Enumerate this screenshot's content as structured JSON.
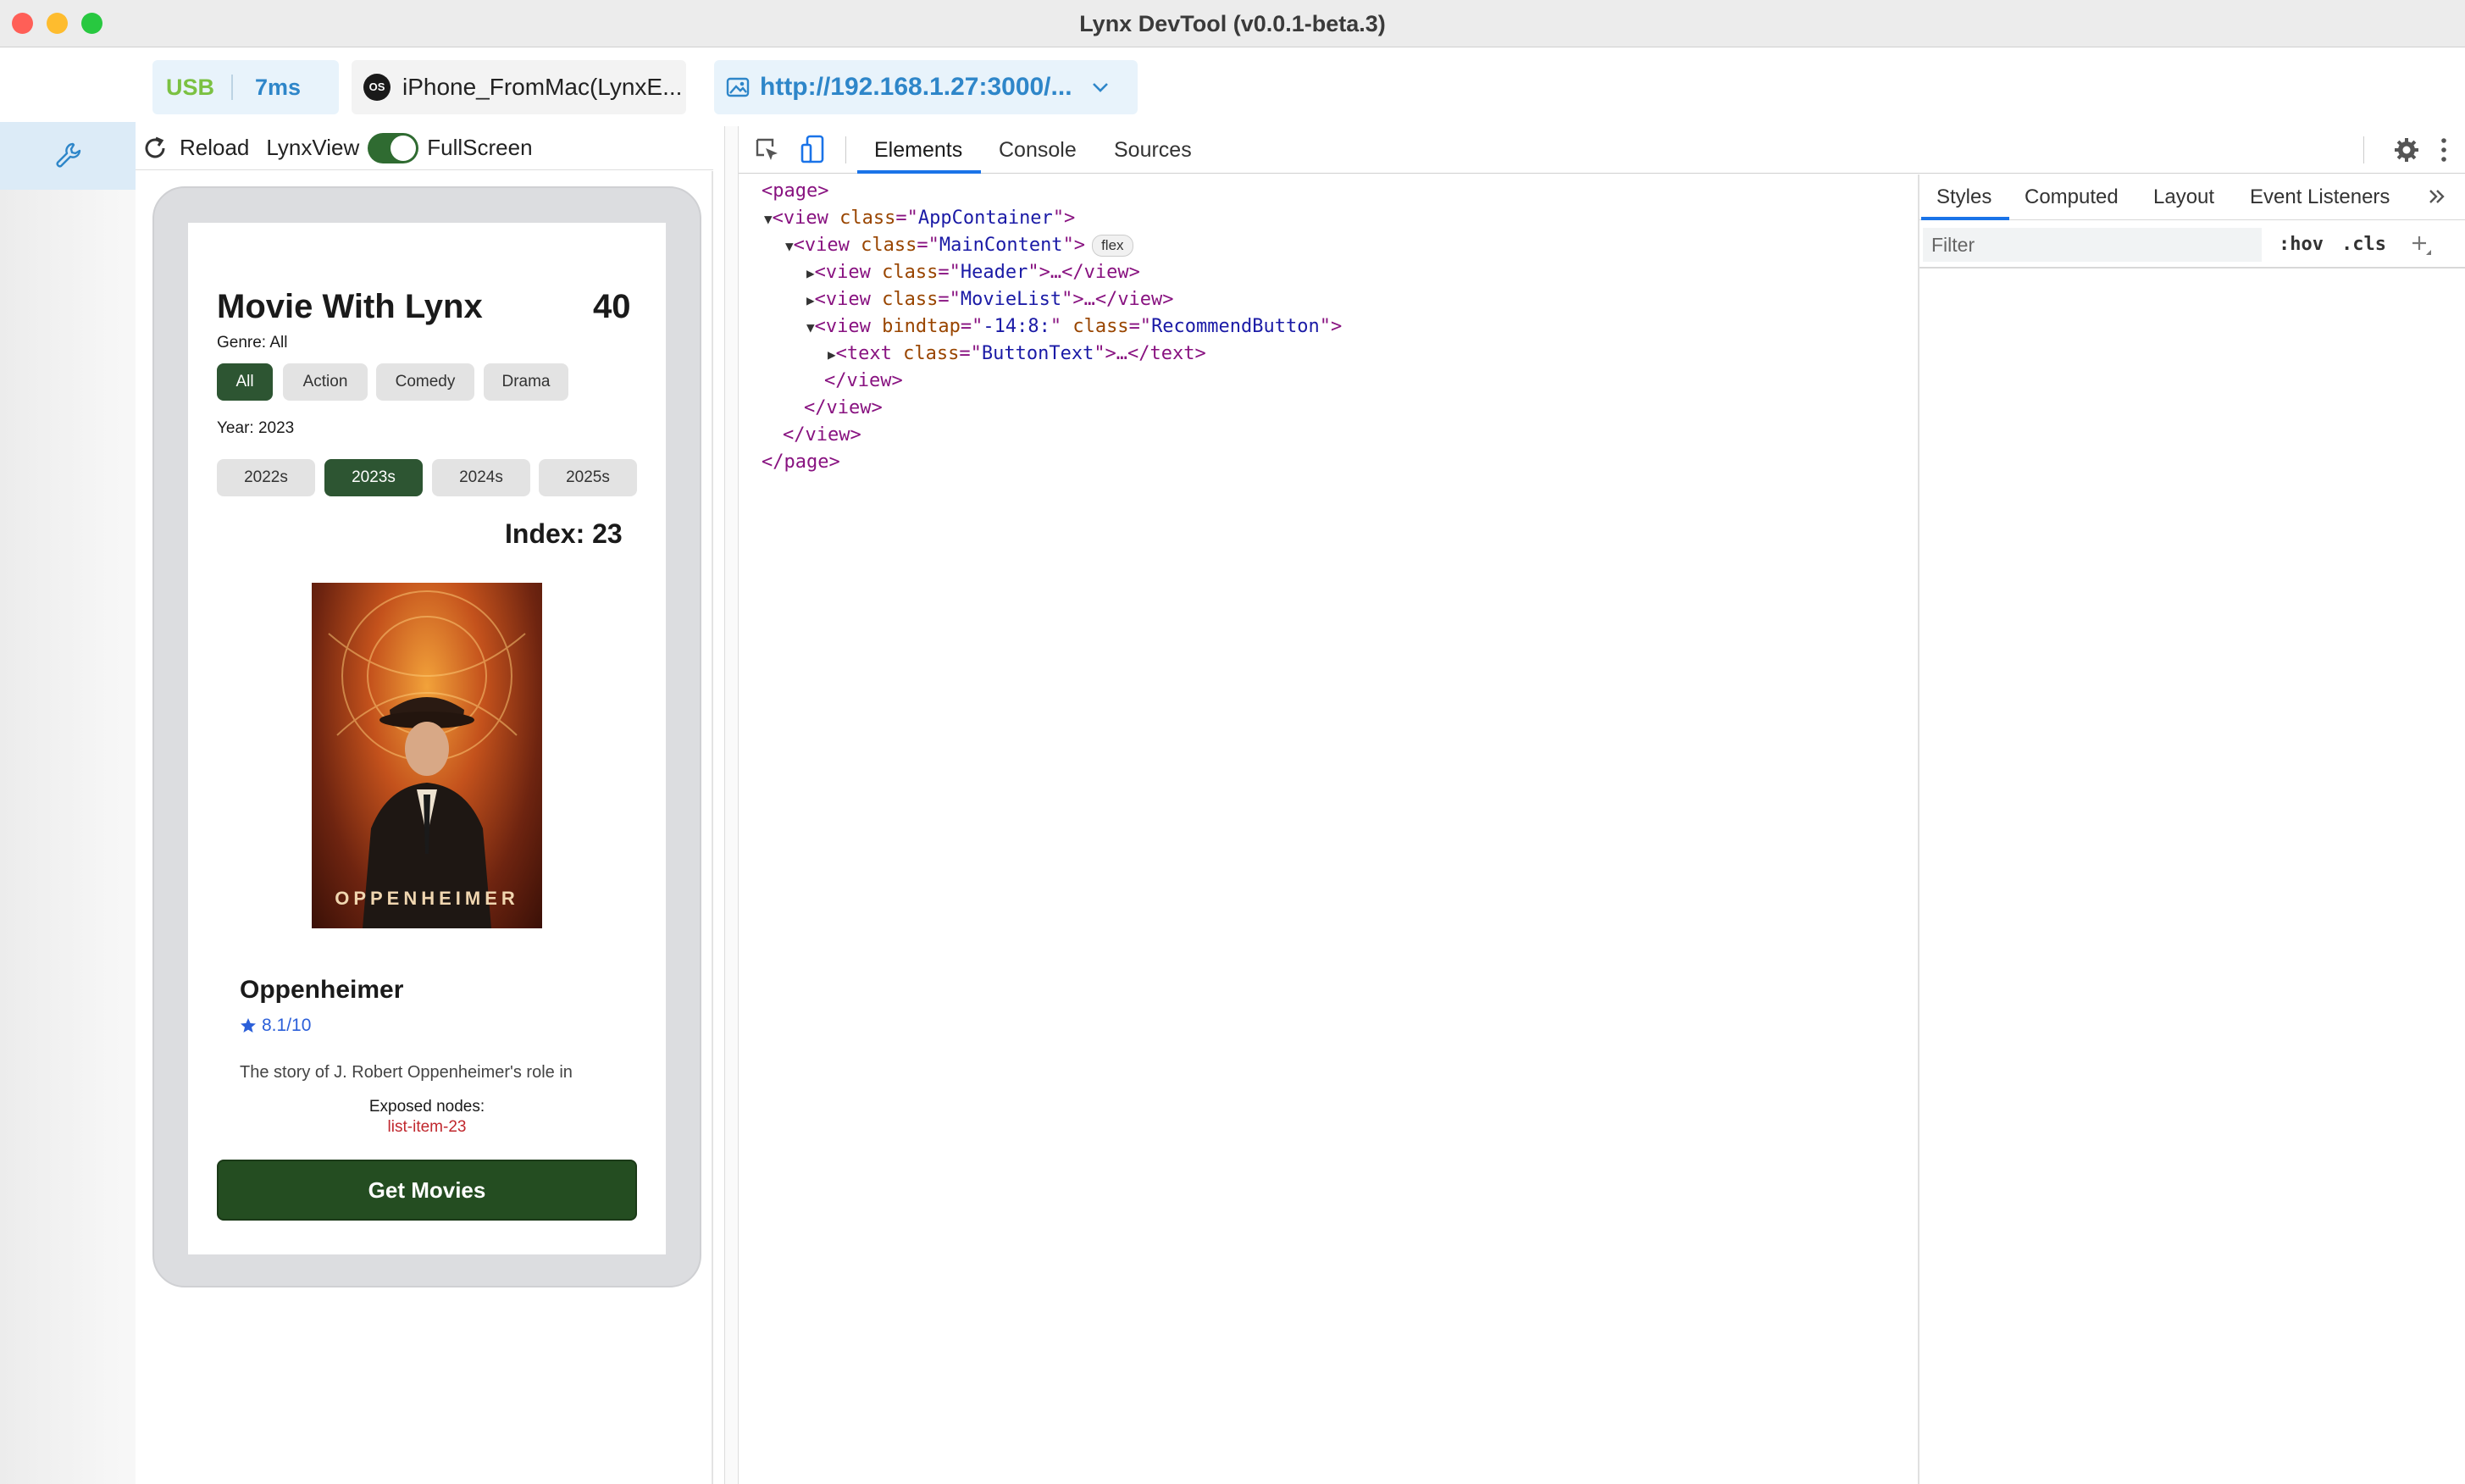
{
  "window": {
    "title": "Lynx DevTool (v0.0.1-beta.3)"
  },
  "toolbar": {
    "connection": "USB",
    "latency": "7ms",
    "os_badge": "OS",
    "device": "iPhone_FromMac(LynxE...",
    "url": "http://192.168.1.27:3000/..."
  },
  "preview": {
    "reload_label": "Reload",
    "lynxview_label": "LynxView",
    "fullscreen_label": "FullScreen",
    "fullscreen_on": true
  },
  "app": {
    "title": "Movie With Lynx",
    "count": "40",
    "genre_label": "Genre: All",
    "genres": [
      "All",
      "Action",
      "Comedy",
      "Drama"
    ],
    "active_genre": "All",
    "year_label": "Year: 2023",
    "years": [
      "2022s",
      "2023s",
      "2024s",
      "2025s"
    ],
    "active_year": "2023s",
    "index_label": "Index: 23",
    "poster_text": "OPPENHEIMER",
    "movie_title": "Oppenheimer",
    "rating": "8.1/10",
    "description": "The story of J. Robert Oppenheimer's role in",
    "exposed_label": "Exposed nodes:",
    "exposed_value": "list-item-23",
    "button": "Get Movies"
  },
  "devtools": {
    "tabs": [
      "Elements",
      "Console",
      "Sources"
    ],
    "active_tab": "Elements",
    "styles_tabs": [
      "Styles",
      "Computed",
      "Layout",
      "Event Listeners"
    ],
    "active_styles_tab": "Styles",
    "filter_placeholder": "Filter",
    "hov": ":hov",
    "cls": ".cls",
    "flex_badge": "flex"
  },
  "dom": {
    "page_open": "page",
    "app_container": {
      "tag": "view",
      "attr": "class",
      "val": "AppContainer"
    },
    "main_content": {
      "tag": "view",
      "attr": "class",
      "val": "MainContent"
    },
    "header": {
      "tag": "view",
      "attr": "class",
      "val": "Header",
      "close": "view"
    },
    "movie_list": {
      "tag": "view",
      "attr": "class",
      "val": "MovieList",
      "close": "view"
    },
    "recommend": {
      "tag": "view",
      "attr1": "bindtap",
      "val1": "-14:8:",
      "attr2": "class",
      "val2": "RecommendButton"
    },
    "button_text": {
      "tag": "text",
      "attr": "class",
      "val": "ButtonText",
      "close": "text"
    },
    "close_view": "view",
    "page_close": "page"
  },
  "colors": {
    "accent": "#1a73e8",
    "app_green": "#2d5532",
    "url_blue": "#2e86c9",
    "usb_green": "#7bc142"
  }
}
